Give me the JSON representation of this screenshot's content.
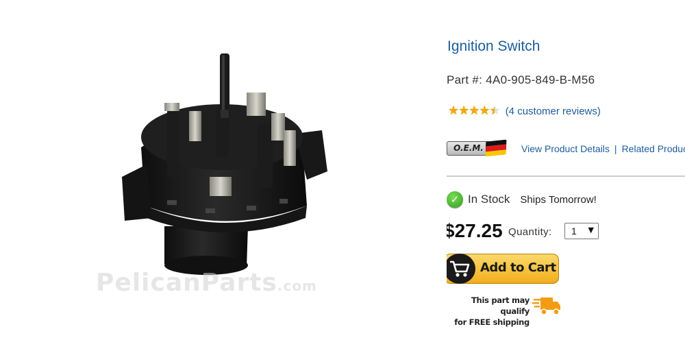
{
  "product": {
    "watermark_name": "PelicanParts",
    "watermark_domain": ".com",
    "title": "Ignition Switch",
    "part_number": "Part #: 4A0-905-849-B-M56",
    "rating": 4.5,
    "reviews_link": "(4 customer reviews)",
    "oem_badge": "O.E.M.",
    "view_details_link": "View Product Details",
    "separator": "|",
    "related_link": "Related Products",
    "stock_status": "In Stock",
    "ships_text": "Ships Tomorrow!",
    "price": "$27.25",
    "quantity_label": "Quantity:",
    "quantity_value": "1",
    "add_to_cart_label": "Add to Cart",
    "free_shipping_line1": "This part may qualify",
    "free_shipping_line2": "for FREE shipping"
  },
  "colors": {
    "link": "#1c5d9a",
    "star": "#f2a900",
    "button": "#f2ad1c",
    "truck": "#f39c12",
    "stock_check": "#2f9d1b"
  },
  "icons": [
    "star-rating-icon",
    "oem-german-flag-icon",
    "in-stock-check-icon",
    "select-arrow-icon",
    "shopping-cart-icon",
    "shipping-truck-icon"
  ]
}
